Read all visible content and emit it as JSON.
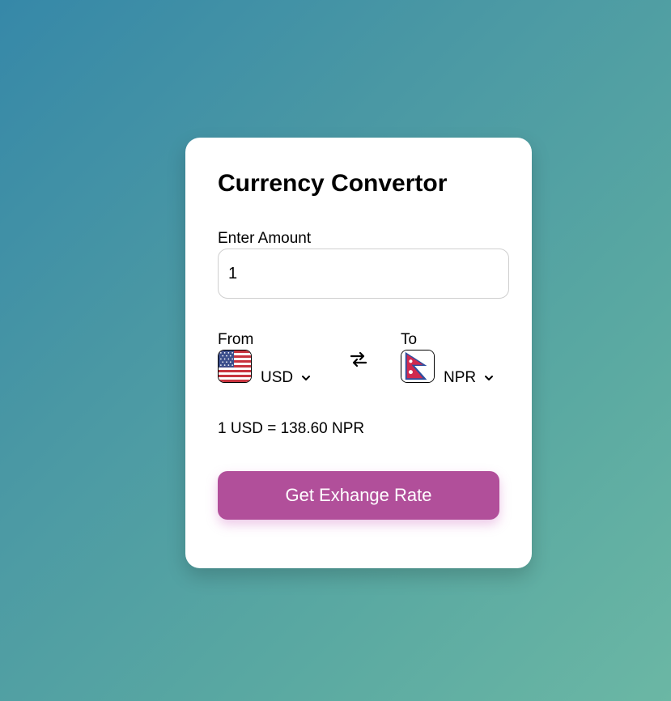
{
  "card": {
    "title": "Currency Convertor",
    "amount_label": "Enter Amount",
    "amount_value": "1",
    "from": {
      "label": "From",
      "currency": "USD",
      "flag": "us-flag-icon"
    },
    "to": {
      "label": "To",
      "currency": "NPR",
      "flag": "nepal-flag-icon"
    },
    "swap_icon": "swap-arrows-icon",
    "rate_text": "1 USD = 138.60 NPR",
    "button_label": "Get Exhange Rate"
  },
  "colors": {
    "background_start": "#3688a8",
    "background_end": "#6bb7a4",
    "card": "#ffffff",
    "button": "#b14f9a",
    "button_text": "#ffffff"
  }
}
